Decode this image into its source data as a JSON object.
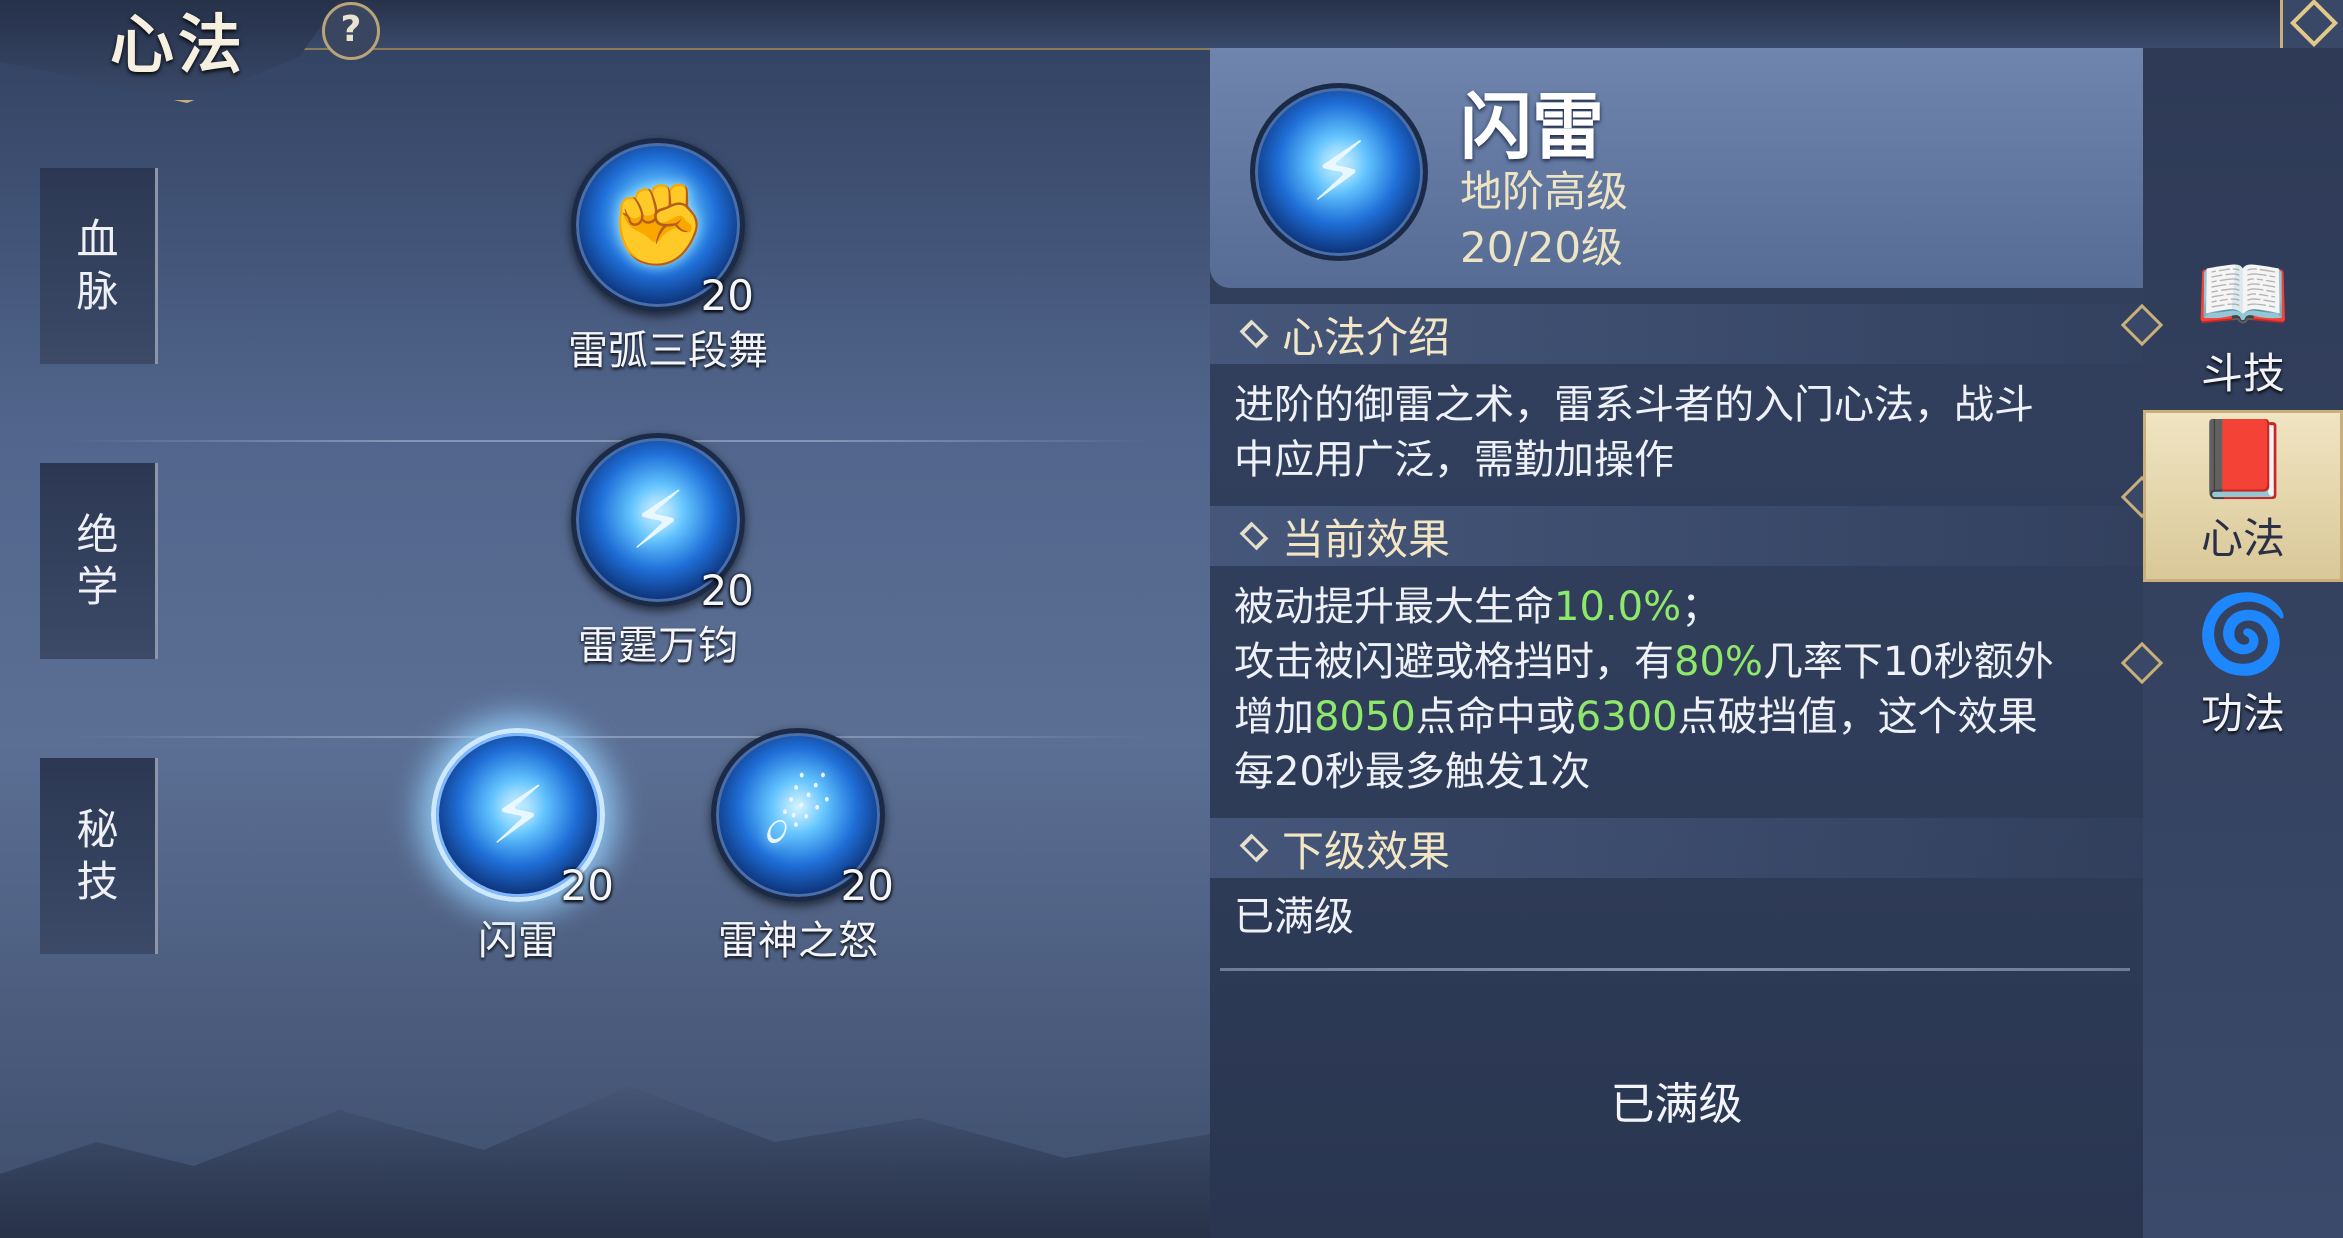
{
  "header": {
    "title": "心法",
    "help": "?"
  },
  "rows": [
    {
      "label_top": "血",
      "label_bottom": "脉",
      "skills": [
        {
          "name": "雷弧三段舞",
          "level": "20",
          "icon": "thunder-fist-icon",
          "glyph": "✊"
        }
      ]
    },
    {
      "label_top": "绝",
      "label_bottom": "学",
      "skills": [
        {
          "name": "雷霆万钧",
          "level": "20",
          "icon": "thunder-pillar-icon",
          "glyph": "⚡"
        }
      ]
    },
    {
      "label_top": "秘",
      "label_bottom": "技",
      "skills": [
        {
          "name": "闪雷",
          "level": "20",
          "icon": "lightning-mage-icon",
          "glyph": "⚡",
          "selected": true
        },
        {
          "name": "雷神之怒",
          "level": "20",
          "icon": "thunder-orb-icon",
          "glyph": "☄"
        }
      ]
    }
  ],
  "detail": {
    "name": "闪雷",
    "rank": "地阶高级",
    "level": "20/20级",
    "icon": "lightning-mage-icon",
    "glyph": "⚡",
    "intro_title": "心法介绍",
    "intro_line1": "进阶的御雷之术，雷系斗者的入门心法，战斗",
    "intro_line2": "中应用广泛，需勤加操作",
    "effect_title": "当前效果",
    "effect_l1_a": "被动提升最大生命",
    "effect_l1_b": "10.0%",
    "effect_l1_c": "；",
    "effect_l2_a": "攻击被闪避或格挡时，有",
    "effect_l2_b": "80%",
    "effect_l2_c": "几率下10秒额外",
    "effect_l3_a": "增加",
    "effect_l3_b": "8050",
    "effect_l3_c": "点命中或",
    "effect_l3_d": "6300",
    "effect_l3_e": "点破挡值，这个效果",
    "effect_l4": "每20秒最多触发1次",
    "next_title": "下级效果",
    "next_body": "已满级",
    "footer": "已满级"
  },
  "tabs": [
    {
      "label": "斗技",
      "icon": "flame-book-icon",
      "glyph": "📖"
    },
    {
      "label": "心法",
      "icon": "open-book-icon",
      "glyph": "📕",
      "active": true
    },
    {
      "label": "功法",
      "icon": "flame-swirl-icon",
      "glyph": "🌀"
    }
  ],
  "colors": {
    "accent_gold": "#c9b07a",
    "green_value": "#8ee86a"
  }
}
